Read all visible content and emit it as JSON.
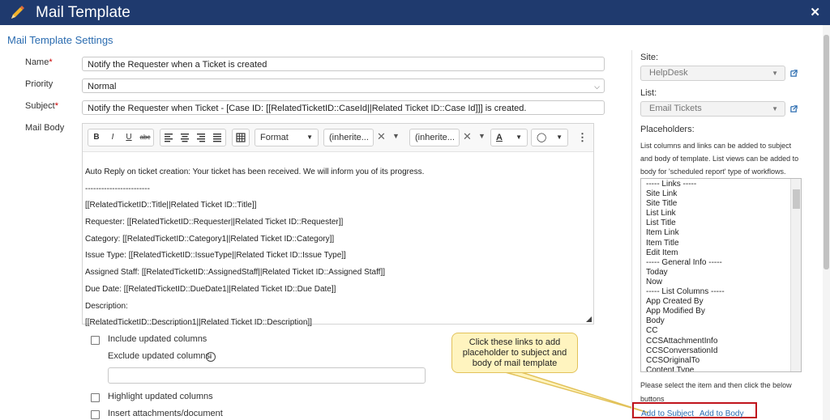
{
  "window": {
    "title": "Mail Template"
  },
  "section_title": "Mail Template Settings",
  "form": {
    "name_label": "Name",
    "name_value": "Notify the Requester when a Ticket is created",
    "priority_label": "Priority",
    "priority_value": "Normal",
    "subject_label": "Subject",
    "subject_value": "Notify the Requester when Ticket - [Case ID: [[RelatedTicketID::CaseId||Related Ticket ID::Case Id]]] is created.",
    "body_label": "Mail Body",
    "required_mark": "*"
  },
  "toolbar": {
    "bold": "B",
    "italic": "I",
    "underline": "U",
    "strike": "abc",
    "format_label": "Format",
    "font_label": "(inherite...",
    "size_label": "(inherite..."
  },
  "body_lines": [
    "Auto Reply on ticket creation: Your ticket has been received. We will inform you of its progress.",
    "------------------------",
    "[[RelatedTicketID::Title||Related Ticket ID::Title]]",
    "Requester: [[RelatedTicketID::Requester||Related Ticket ID::Requester]]",
    "Category: [[RelatedTicketID::Category1||Related Ticket ID::Category]]",
    "Issue Type: [[RelatedTicketID::IssueType||Related Ticket ID::Issue Type]]",
    "Assigned Staff: [[RelatedTicketID::AssignedStaff||Related Ticket ID::Assigned Staff]]",
    "Due Date: [[RelatedTicketID::DueDate1||Related Ticket ID::Due Date]]",
    "Description:",
    "[[RelatedTicketID::Description1||Related Ticket ID::Description]]"
  ],
  "options": {
    "include_updated": "Include updated columns",
    "exclude_updated": "Exclude updated columns",
    "exclude_value": "",
    "highlight_updated": "Highlight updated columns",
    "insert_attachments": "Insert attachments/document"
  },
  "callout": {
    "text": "Click these links to add placeholder to subject and body of mail template"
  },
  "right_panel": {
    "site_label": "Site:",
    "site_value": "HelpDesk",
    "list_label": "List:",
    "list_value": "Email Tickets",
    "placeholders_label": "Placeholders:",
    "help_text": "List columns and links can be added to subject and body of template. List views can be added to body for 'scheduled report' type of workflows.",
    "placeholder_items": [
      "----- Links -----",
      "Site Link",
      "Site Title",
      "List Link",
      "List Title",
      "Item Link",
      "Item Title",
      "Edit Item",
      "----- General Info -----",
      "Today",
      "Now",
      "----- List Columns -----",
      "App Created By",
      "App Modified By",
      "Body",
      "CC",
      "CCSAttachmentInfo",
      "CCSConversationId",
      "CCSOriginalTo",
      "Content Type"
    ],
    "select_note": "Please select the item and then click the below buttons",
    "add_to_subject": "Add to Subject",
    "add_to_body": "Add to Body"
  },
  "colors": {
    "titlebar": "#1f3a6e",
    "link": "#2b6cb0",
    "highlight_box": "#c0141c",
    "callout_fill": "#fff4bf"
  }
}
